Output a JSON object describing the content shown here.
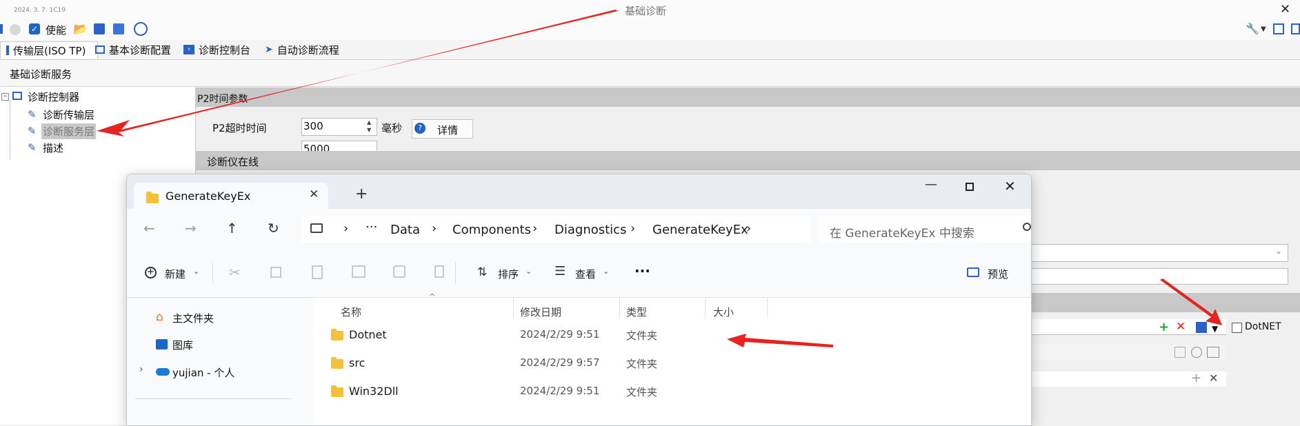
{
  "window": {
    "title": "基础诊断",
    "date": "2024. 3. 7. 1C19"
  },
  "toolbar": {
    "enable_label": "使能",
    "enabled": true
  },
  "tabs": [
    {
      "label": "传输层(ISO TP)"
    },
    {
      "label": "基本诊断配置"
    },
    {
      "label": "诊断控制台"
    },
    {
      "label": "自动诊断流程"
    }
  ],
  "section_title": "基础诊断服务",
  "tree": {
    "root": "诊断控制器",
    "children": [
      "诊断传输层",
      "诊断服务层",
      "描述"
    ],
    "selected_index": 1
  },
  "right": {
    "p2_band": "P2时间参数",
    "p2_timeout_label": "P2超时时间",
    "p2_timeout_value": "300",
    "unit_ms": "毫秒",
    "detail_button": "详情",
    "p2_star_value": "5000",
    "online_band": "诊断仪在线",
    "dotnet_label": "DotNET"
  },
  "explorer": {
    "tab_title": "GenerateKeyEx",
    "new_tab_glyph": "+",
    "breadcrumb": [
      "Data",
      "Components",
      "Diagnostics",
      "GenerateKeyEx"
    ],
    "ellipsis": "···",
    "search_placeholder": "在 GenerateKeyEx 中搜索",
    "cmd": {
      "new": "新建",
      "sort": "排序",
      "view": "查看",
      "more": "···",
      "preview": "预览"
    },
    "nav": [
      "主文件夹",
      "图库",
      "yujian - 个人"
    ],
    "columns": [
      "名称",
      "修改日期",
      "类型",
      "大小"
    ],
    "files": [
      {
        "name": "Dotnet",
        "date": "2024/2/29 9:51",
        "type": "文件夹"
      },
      {
        "name": "src",
        "date": "2024/2/29 9:57",
        "type": "文件夹"
      },
      {
        "name": "Win32Dll",
        "date": "2024/2/29 9:51",
        "type": "文件夹"
      }
    ]
  },
  "colors": {
    "accent_blue": "#1e63c7",
    "annotation_red": "#e8221e",
    "band_gray": "#c8c8c8"
  }
}
